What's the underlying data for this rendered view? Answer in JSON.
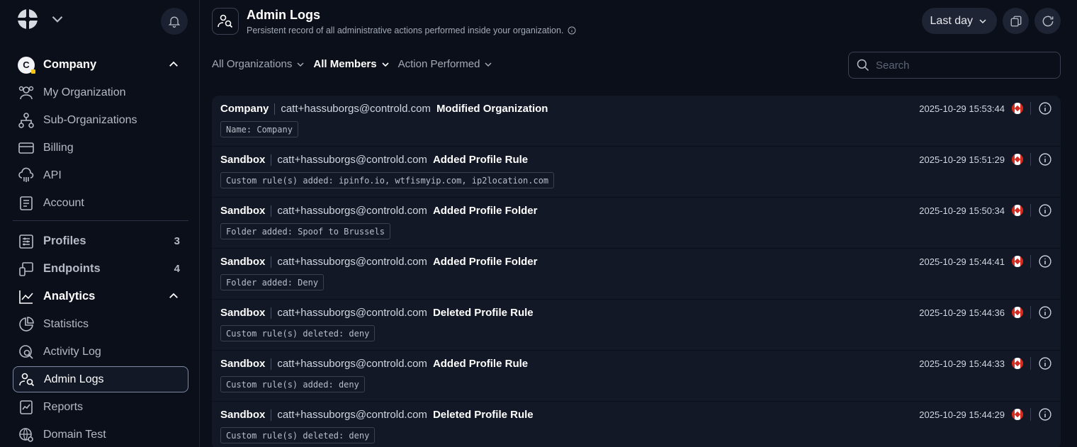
{
  "sidebar": {
    "company": {
      "badge": "C",
      "label": "Company"
    },
    "company_items": [
      {
        "label": "My Organization",
        "icon": "users-icon"
      },
      {
        "label": "Sub-Organizations",
        "icon": "org-tree-icon"
      },
      {
        "label": "Billing",
        "icon": "credit-card-icon"
      },
      {
        "label": "API",
        "icon": "cloud-code-icon"
      },
      {
        "label": "Account",
        "icon": "document-icon"
      }
    ],
    "profiles": {
      "label": "Profiles",
      "count": "3"
    },
    "endpoints": {
      "label": "Endpoints",
      "count": "4"
    },
    "analytics": {
      "label": "Analytics"
    },
    "analytics_items": [
      {
        "label": "Statistics",
        "icon": "pie-chart-icon"
      },
      {
        "label": "Activity Log",
        "icon": "activity-search-icon"
      },
      {
        "label": "Admin Logs",
        "icon": "admin-search-icon"
      },
      {
        "label": "Reports",
        "icon": "report-icon"
      },
      {
        "label": "Domain Test",
        "icon": "globe-search-icon"
      }
    ]
  },
  "header": {
    "title": "Admin Logs",
    "subtitle": "Persistent record of all administrative actions performed inside your organization.",
    "time_range": "Last day"
  },
  "filters": {
    "organizations": "All Organizations",
    "members": "All Members",
    "action": "Action Performed"
  },
  "search": {
    "placeholder": "Search"
  },
  "logs": [
    {
      "org": "Company",
      "email": "catt+hassuborgs@controld.com",
      "action": "Modified Organization",
      "detail": "Name: Company",
      "timestamp": "2025-10-29 15:53:44"
    },
    {
      "org": "Sandbox",
      "email": "catt+hassuborgs@controld.com",
      "action": "Added Profile Rule",
      "detail": "Custom rule(s) added: ipinfo.io, wtfismyip.com, ip2location.com",
      "timestamp": "2025-10-29 15:51:29"
    },
    {
      "org": "Sandbox",
      "email": "catt+hassuborgs@controld.com",
      "action": "Added Profile Folder",
      "detail": "Folder added: Spoof to Brussels",
      "timestamp": "2025-10-29 15:50:34"
    },
    {
      "org": "Sandbox",
      "email": "catt+hassuborgs@controld.com",
      "action": "Added Profile Folder",
      "detail": "Folder added: Deny",
      "timestamp": "2025-10-29 15:44:41"
    },
    {
      "org": "Sandbox",
      "email": "catt+hassuborgs@controld.com",
      "action": "Deleted Profile Rule",
      "detail": "Custom rule(s) deleted: deny",
      "timestamp": "2025-10-29 15:44:36"
    },
    {
      "org": "Sandbox",
      "email": "catt+hassuborgs@controld.com",
      "action": "Added Profile Rule",
      "detail": "Custom rule(s) added: deny",
      "timestamp": "2025-10-29 15:44:33"
    },
    {
      "org": "Sandbox",
      "email": "catt+hassuborgs@controld.com",
      "action": "Deleted Profile Rule",
      "detail": "Custom rule(s) deleted: deny",
      "timestamp": "2025-10-29 15:44:29"
    }
  ],
  "colors": {
    "background": "#0b0f19",
    "panel": "#131826",
    "flag_red": "#d52b1e"
  }
}
